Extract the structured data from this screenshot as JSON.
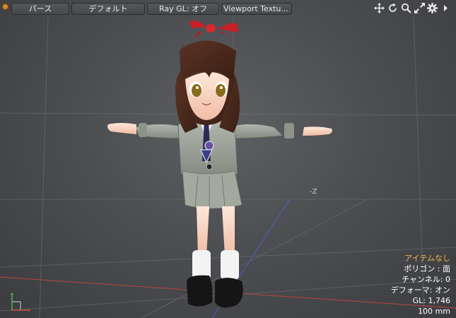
{
  "toolbar": {
    "view_mode": "パース",
    "shading": "デフォルト",
    "ray_gl": "Ray GL: オフ",
    "viewport_texture": "Viewport Textu..."
  },
  "tool_icons": [
    "move-view-icon",
    "rotate-view-icon",
    "zoom-view-icon",
    "maximize-view-icon",
    "settings-gear-icon",
    "expand-arrow-icon"
  ],
  "axis_label": "-Z",
  "info": {
    "item": "アイテムなし",
    "polygon": "ポリゴン : 面",
    "channel": "チャンネル: 0",
    "deformer": "デフォーマ: オン",
    "gl": "GL: 1,746",
    "unit": "100 mm"
  },
  "colors": {
    "accent": "#f0b24a",
    "x_axis": "#b5473f",
    "z_axis": "#4a63c4"
  }
}
